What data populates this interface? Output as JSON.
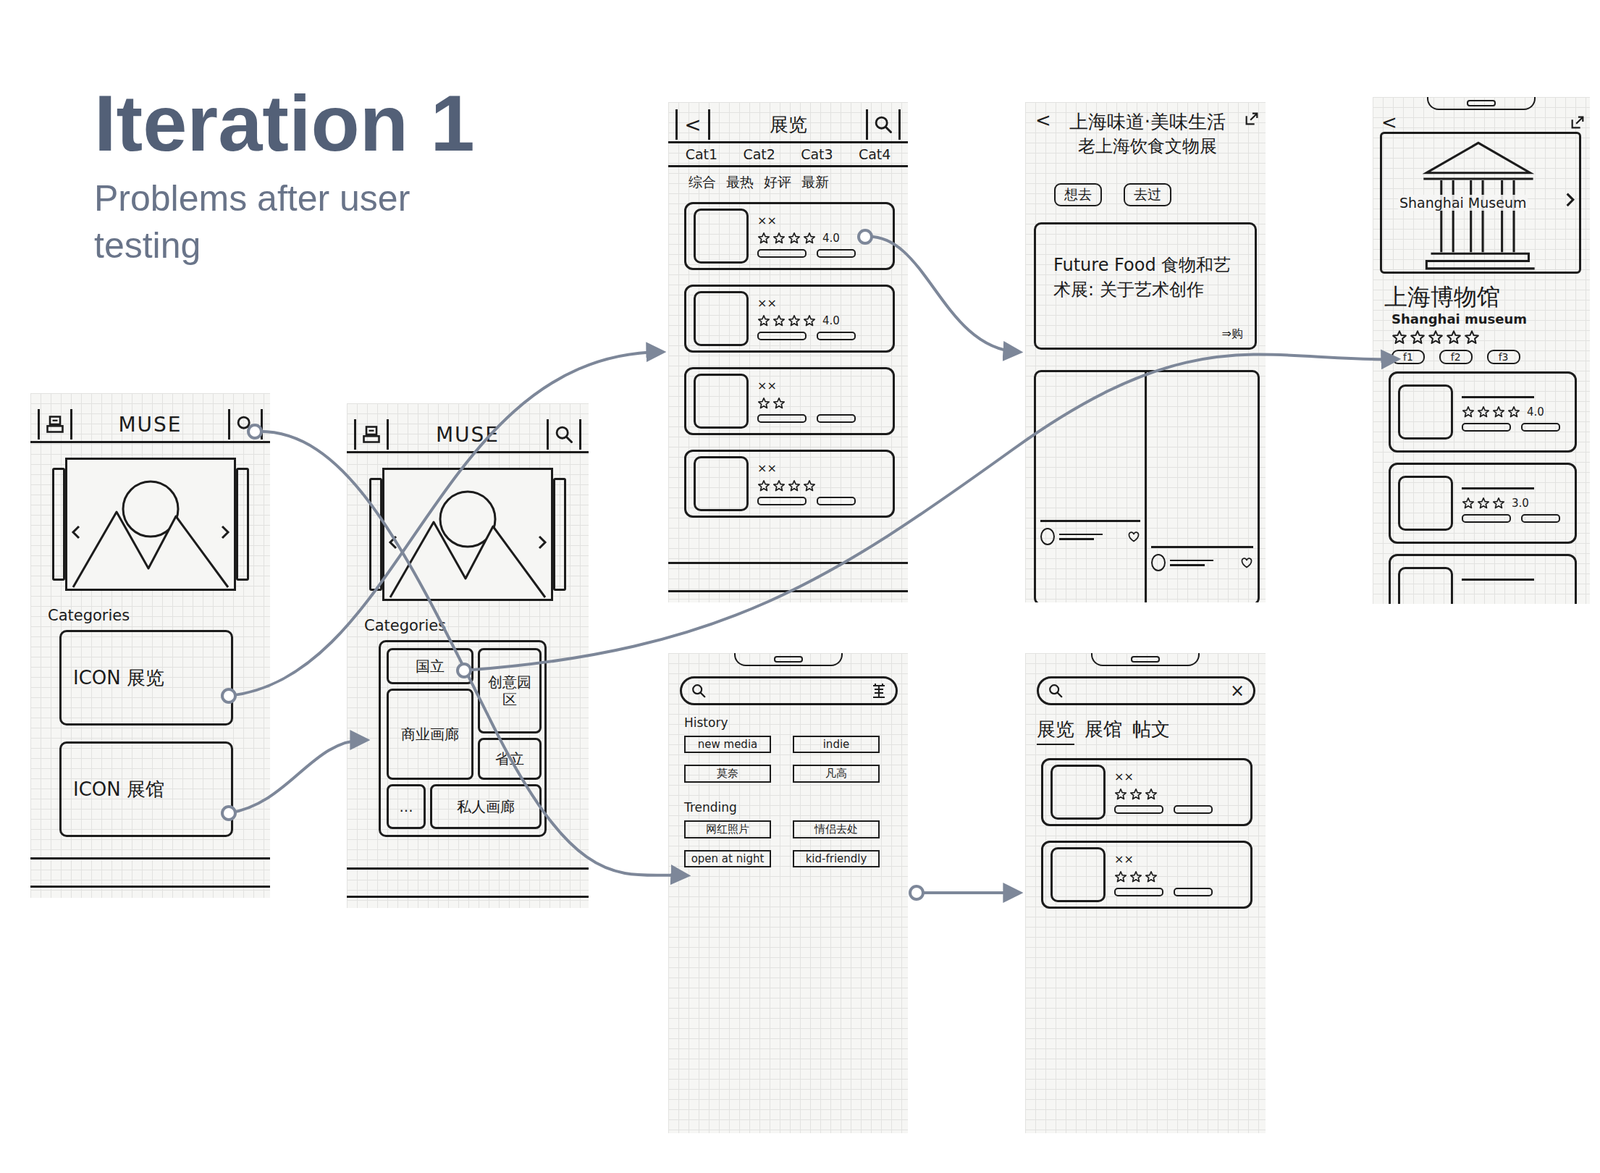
{
  "heading": {
    "title": "Iteration 1",
    "subtitle": "Problems after user testing"
  },
  "home": {
    "logo": "MUSE",
    "section": "Categories",
    "categories": [
      "ICON 展览",
      "ICON 展馆"
    ]
  },
  "venues": {
    "logo": "MUSE",
    "section": "Categories",
    "tiles": [
      "国立",
      "创意园区",
      "商业画廊",
      "省立",
      "...",
      "私人画廊"
    ]
  },
  "exhibitions": {
    "back": "<",
    "title": "展览",
    "categories": [
      "Cat1",
      "Cat2",
      "Cat3",
      "Cat4"
    ],
    "sorts": [
      "综合",
      "最热",
      "好评",
      "最新"
    ],
    "cards": [
      {
        "name": "××",
        "stars": 4,
        "rating": "4.0"
      },
      {
        "name": "××",
        "stars": 4,
        "rating": "4.0"
      },
      {
        "name": "××",
        "stars": 2
      },
      {
        "name": "××",
        "stars": 4
      }
    ]
  },
  "exhibit": {
    "back": "<",
    "title": "上海味道·美味生活",
    "subtitle": "老上海饮食文物展",
    "actions": [
      "想去",
      "去过"
    ],
    "feature": {
      "text": "Future Food 食物和艺术展: 关于艺术创作",
      "link": "⇒购"
    },
    "posts": [
      {
        "liked": false
      },
      {
        "liked": false
      }
    ]
  },
  "museum": {
    "back": "<",
    "image_caption": "Shanghai Museum",
    "name": "上海博物馆",
    "name_en": "Shanghai museum",
    "stars": 5,
    "tags": [
      "f1",
      "f2",
      "f3"
    ],
    "cards": [
      {
        "stars": 4,
        "rating": "4.0"
      },
      {
        "stars": 3,
        "rating": "3.0"
      },
      {
        "stars": 0
      }
    ]
  },
  "search": {
    "history_label": "History",
    "history": [
      "new media",
      "indie",
      "莫奈",
      "凡高"
    ],
    "trending_label": "Trending",
    "trending": [
      "网红照片",
      "情侣去处",
      "open at night",
      "kid-friendly"
    ]
  },
  "results": {
    "clear": "×",
    "tabs": [
      {
        "label": "展览",
        "selected": true
      },
      {
        "label": "展馆",
        "selected": false
      },
      {
        "label": "帖文",
        "selected": false
      }
    ],
    "cards": [
      {
        "name": "××",
        "stars": 3
      },
      {
        "name": "××",
        "stars": 3
      }
    ]
  }
}
